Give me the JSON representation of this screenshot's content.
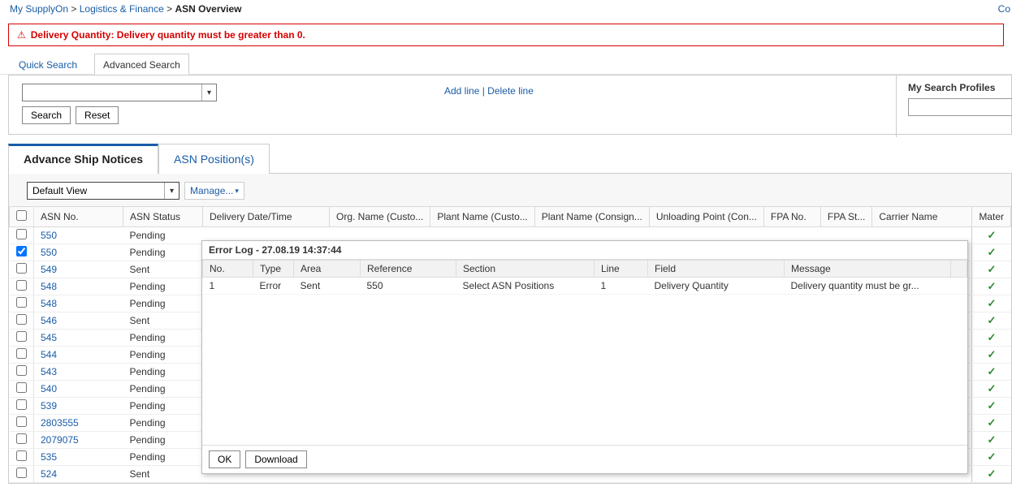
{
  "breadcrumb": {
    "l1": "My SupplyOn",
    "l2": "Logistics & Finance",
    "l3": "ASN Overview"
  },
  "topRight": "Co",
  "alert": {
    "msg": "Delivery Quantity: Delivery quantity must be greater than 0."
  },
  "searchTabs": {
    "quick": "Quick Search",
    "advanced": "Advanced Search"
  },
  "searchActions": {
    "search": "Search",
    "reset": "Reset",
    "addLine": "Add line",
    "delLine": "Delete line"
  },
  "profiles": {
    "label": "My Search Profiles"
  },
  "mainTabs": {
    "asn": "Advance Ship Notices",
    "pos": "ASN Position(s)"
  },
  "view": {
    "default": "Default View",
    "manage": "Manage..."
  },
  "columns": {
    "asnNo": "ASN No.",
    "status": "ASN Status",
    "deliv": "Delivery Date/Time",
    "orgCust": "Org. Name (Custo...",
    "plantCust": "Plant Name (Custo...",
    "plantCons": "Plant Name (Consign...",
    "unload": "Unloading Point (Con...",
    "fpaNo": "FPA No.",
    "fpaSt": "FPA St...",
    "carrier": "Carrier Name",
    "mater": "Mater"
  },
  "rows": [
    {
      "no": "550",
      "status": "Pending",
      "chk": false
    },
    {
      "no": "550",
      "status": "Pending",
      "chk": true
    },
    {
      "no": "549",
      "status": "Sent",
      "chk": false
    },
    {
      "no": "548",
      "status": "Pending",
      "chk": false
    },
    {
      "no": "548",
      "status": "Pending",
      "chk": false
    },
    {
      "no": "546",
      "status": "Sent",
      "chk": false
    },
    {
      "no": "545",
      "status": "Pending",
      "chk": false
    },
    {
      "no": "544",
      "status": "Pending",
      "chk": false
    },
    {
      "no": "543",
      "status": "Pending",
      "chk": false
    },
    {
      "no": "540",
      "status": "Pending",
      "chk": false
    },
    {
      "no": "539",
      "status": "Pending",
      "chk": false
    },
    {
      "no": "2803555",
      "status": "Pending",
      "chk": false
    },
    {
      "no": "2079075",
      "status": "Pending",
      "chk": false
    },
    {
      "no": "535",
      "status": "Pending",
      "chk": false
    },
    {
      "no": "524",
      "status": "Sent",
      "chk": false
    }
  ],
  "errorLog": {
    "title": "Error Log - 27.08.19 14:37:44",
    "cols": {
      "no": "No.",
      "type": "Type",
      "area": "Area",
      "ref": "Reference",
      "section": "Section",
      "line": "Line",
      "field": "Field",
      "msg": "Message"
    },
    "rows": [
      {
        "no": "1",
        "type": "Error",
        "area": "Sent",
        "ref": "550",
        "section": "Select ASN Positions",
        "line": "1",
        "field": "Delivery Quantity",
        "msg": "Delivery quantity must be gr..."
      }
    ],
    "ok": "OK",
    "download": "Download"
  }
}
